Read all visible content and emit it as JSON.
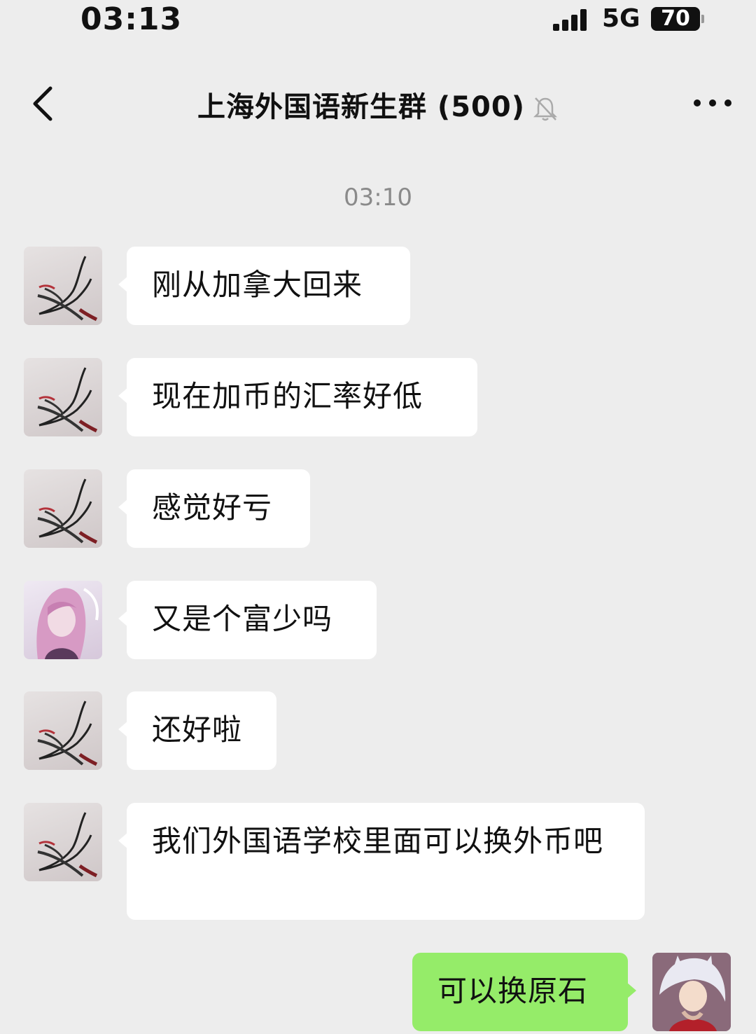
{
  "status_bar": {
    "time": "03:13",
    "network": "5G",
    "battery": "70"
  },
  "nav": {
    "title": "上海外国语新生群 (500)"
  },
  "chat": {
    "timestamp": "03:10",
    "messages": [
      {
        "sender": "ink-avatar",
        "text": "刚从加拿大回来"
      },
      {
        "sender": "ink-avatar",
        "text": "现在加币的汇率好低"
      },
      {
        "sender": "ink-avatar",
        "text": "感觉好亏"
      },
      {
        "sender": "pink-avatar",
        "text": "又是个富少吗"
      },
      {
        "sender": "ink-avatar",
        "text": "还好啦"
      },
      {
        "sender": "ink-avatar",
        "text": "我们外国语学校里面可以换外币吧"
      },
      {
        "sender": "self",
        "text": "可以换原石"
      }
    ]
  },
  "colors": {
    "background": "#ededed",
    "incoming_bubble": "#ffffff",
    "outgoing_bubble": "#95ec69",
    "timestamp": "#8a8a8a"
  },
  "icons": [
    "chevron-left-icon",
    "bell-muted-icon",
    "more-dots-icon",
    "signal-icon",
    "battery-icon"
  ]
}
